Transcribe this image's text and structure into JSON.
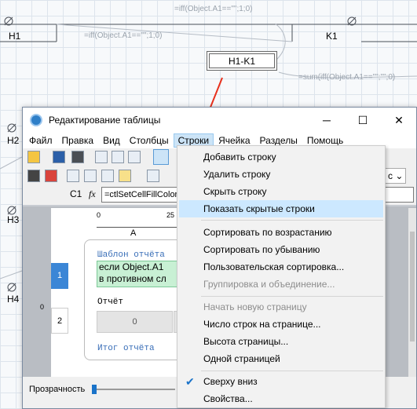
{
  "diagram": {
    "nodes": [
      {
        "label": "H1"
      },
      {
        "label": "K1"
      },
      {
        "label": "H1-K1"
      },
      {
        "label": "H2"
      },
      {
        "label": "H3"
      },
      {
        "label": "H4"
      }
    ],
    "edge_labels": [
      "=iff(Object.A1==\"\";1;0)",
      "=iff(Object.A1==\"\";1;0)",
      "=sum(iff(Object.A1==\"\";\"\";0)"
    ]
  },
  "window": {
    "title": "Редактирование таблицы",
    "menu": [
      "Файл",
      "Правка",
      "Вид",
      "Столбцы",
      "Строки",
      "Ячейка",
      "Разделы",
      "Помощь"
    ],
    "active_menu": "Строки",
    "minimize": "─",
    "maximize": "☐",
    "close": "✕",
    "cell_ref": "C1",
    "fx": "fx",
    "formula": "=ctlSetCellFillColor(",
    "right_combo": "с",
    "ruler": {
      "col_a": "A",
      "tick0": "0",
      "tick25": "25"
    },
    "rows": [
      {
        "num": "1",
        "content": "Шаблон отчёта",
        "cell1": "если Object.A1",
        "cell2": "в противном сл"
      },
      {
        "num": "2",
        "content": "Отчёт",
        "value": "0"
      }
    ],
    "row_ruler_0": "0",
    "footer_text": "Итог отчёта",
    "transparency": "Прозрачность"
  },
  "context_menu": {
    "items": [
      {
        "label": "Добавить строку",
        "state": "normal"
      },
      {
        "label": "Удалить строку",
        "state": "normal"
      },
      {
        "label": "Скрыть строку",
        "state": "normal"
      },
      {
        "label": "Показать скрытые строки",
        "state": "highlight"
      },
      {
        "label": "Сортировать по возрастанию",
        "state": "normal"
      },
      {
        "label": "Сортировать по убыванию",
        "state": "normal"
      },
      {
        "label": "Пользовательская сортировка...",
        "state": "normal"
      },
      {
        "label": "Группировка и объединение...",
        "state": "disabled"
      },
      {
        "label": "Начать новую страницу",
        "state": "disabled"
      },
      {
        "label": "Число строк на странице...",
        "state": "normal"
      },
      {
        "label": "Высота страницы...",
        "state": "normal"
      },
      {
        "label": "Одной страницей",
        "state": "normal"
      },
      {
        "label": "Сверху вниз",
        "state": "checked"
      },
      {
        "label": "Свойства...",
        "state": "normal"
      }
    ]
  },
  "colors": {
    "arrow": "#e8301c",
    "highlight": "#cce8ff",
    "accent": "#1a73c9"
  }
}
